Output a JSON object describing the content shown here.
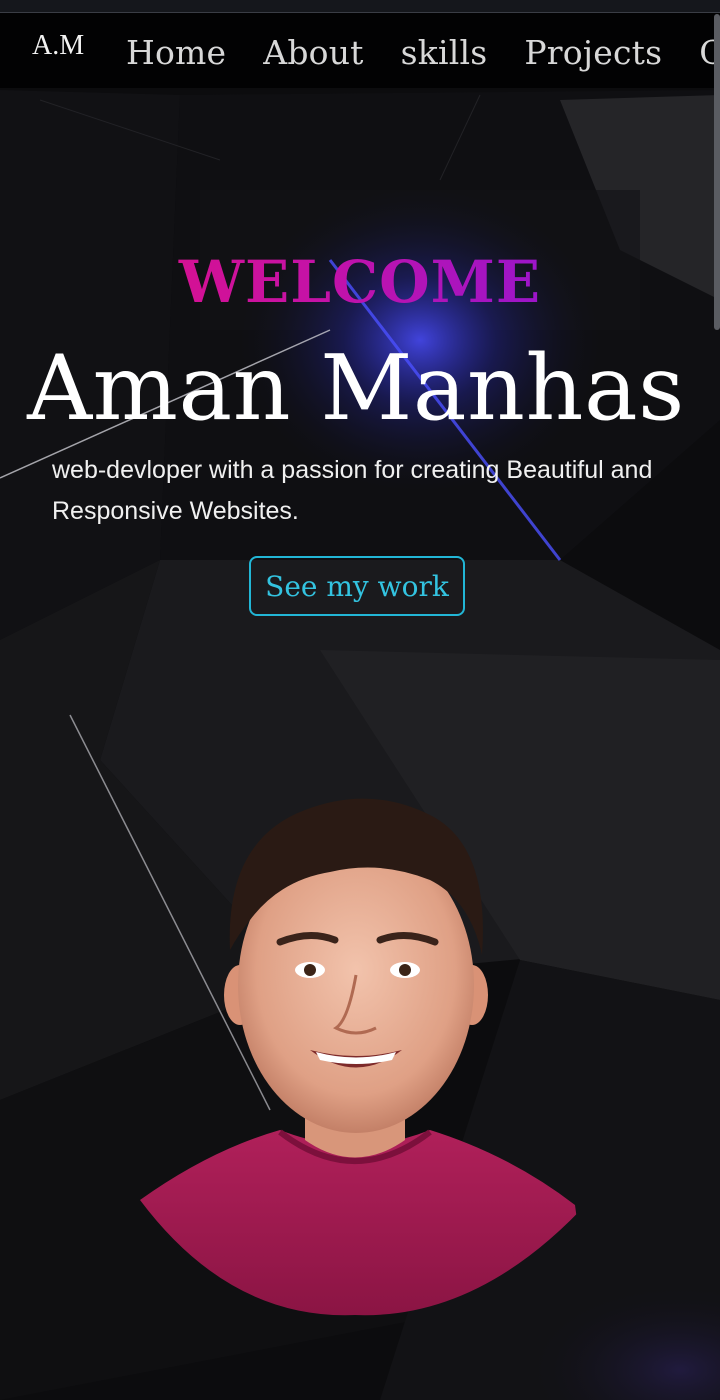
{
  "nav": {
    "logo": "A.M",
    "links": [
      "Home",
      "About",
      "skills",
      "Projects",
      "Contact"
    ]
  },
  "hero": {
    "welcome": "WELCOME",
    "name": "Aman Manhas",
    "tagline": "web-devloper with a passion for creating Beautiful and Responsive Websites.",
    "cta": "See my work"
  },
  "colors": {
    "background": "#0c0c0e",
    "welcome_gradient_start": "#e8107a",
    "welcome_gradient_end": "#7a18e6",
    "cta_accent": "#22b6d6",
    "glow": "#3a3dff"
  },
  "icons": {
    "avatar": "profile-photo"
  }
}
